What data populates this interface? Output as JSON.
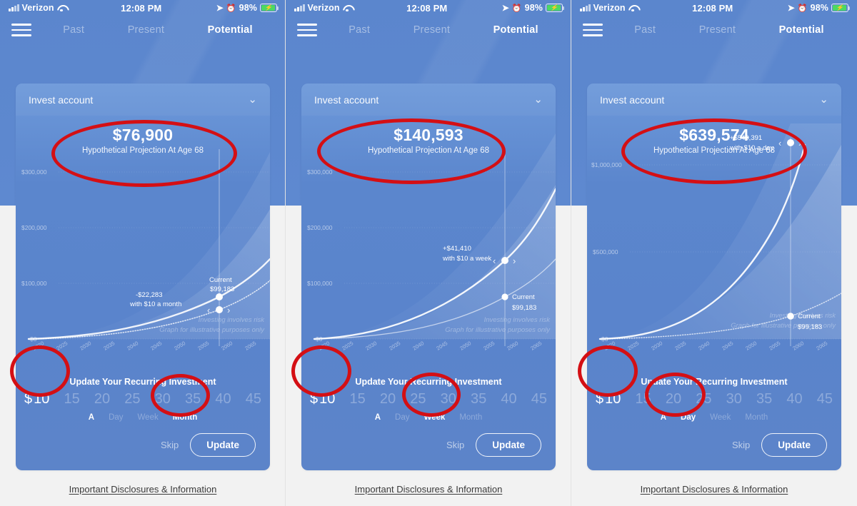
{
  "status_bar": {
    "carrier": "Verizon",
    "time": "12:08 PM",
    "battery_pct": "98%",
    "icons": [
      "signal-bars-icon",
      "wifi-icon",
      "location-arrow-icon",
      "alarm-clock-icon",
      "battery-charging-icon"
    ]
  },
  "nav": {
    "menu_icon": "hamburger-menu-icon",
    "tabs": [
      {
        "label": "Past",
        "active": false
      },
      {
        "label": "Present",
        "active": false
      },
      {
        "label": "Potential",
        "active": true
      }
    ]
  },
  "card": {
    "account_label": "Invest account",
    "chevron_icon": "chevron-down-icon",
    "projection_subtitle": "Hypothetical Projection At Age 68"
  },
  "controls": {
    "title": "Update Your Recurring Investment",
    "amounts": [
      "10",
      "15",
      "20",
      "25",
      "30",
      "35",
      "40",
      "45"
    ],
    "dollar_sign": "$",
    "prefix_a": "A",
    "frequencies": [
      "Day",
      "Week",
      "Month"
    ],
    "skip_label": "Skip",
    "update_label": "Update"
  },
  "footer": {
    "disclosure": "Important Disclosures & Information"
  },
  "chart_common": {
    "x_ticks": [
      "2020",
      "2025",
      "2030",
      "2035",
      "2040",
      "2045",
      "2050",
      "2055",
      "2060",
      "2065"
    ],
    "disclaimer_line1": "Investing involves risk",
    "disclaimer_line2": "Graph for illustrative purposes only",
    "current_label": "Current",
    "current_value": "$99,183",
    "marker_left_icon": "chevron-left-icon",
    "marker_right_icon": "chevron-right-icon"
  },
  "accent": {
    "annotation_red": "#d40f14",
    "app_blue": "#5b86cd",
    "card_blue": "#6d99da",
    "battery_green": "#4cd964"
  },
  "panels": [
    {
      "id": "panel-month",
      "projection_amount": "$76,900",
      "selected_amount": "10",
      "selected_frequency": "Month",
      "chart_data": {
        "type": "line",
        "title": "Hypothetical Projection At Age 68",
        "xlabel": "",
        "ylabel": "",
        "x": [
          2020,
          2025,
          2030,
          2035,
          2040,
          2045,
          2050,
          2055,
          2060,
          2065
        ],
        "y_ticks": [
          0,
          100000,
          200000,
          300000
        ],
        "y_tick_labels": [
          "$0",
          "$100,000",
          "$200,000",
          "$300,000"
        ],
        "ylim": [
          0,
          340000
        ],
        "xlim": [
          2020,
          2067
        ],
        "grid": true,
        "legend": "none",
        "annotations": [
          {
            "text": "-$22,283",
            "subtext": "with $10 a month",
            "x": 2052,
            "y": 62000
          },
          {
            "text": "Current",
            "subtext": "$99,183",
            "x": 2061,
            "y": 110000
          }
        ],
        "series": [
          {
            "name": "current",
            "values": [
              1000,
              3000,
              7000,
              14000,
              24000,
              38000,
              57000,
              78000,
              99183,
              128000
            ],
            "style": "solid"
          },
          {
            "name": "with-contribution",
            "values": [
              900,
              2600,
              6000,
              12000,
              20500,
              32000,
              47000,
              62000,
              76900,
              98000
            ],
            "style": "dotted"
          }
        ]
      }
    },
    {
      "id": "panel-week",
      "projection_amount": "$140,593",
      "selected_amount": "10",
      "selected_frequency": "Week",
      "chart_data": {
        "type": "line",
        "title": "Hypothetical Projection At Age 68",
        "xlabel": "",
        "ylabel": "",
        "x": [
          2020,
          2025,
          2030,
          2035,
          2040,
          2045,
          2050,
          2055,
          2060,
          2065
        ],
        "y_ticks": [
          0,
          100000,
          200000,
          300000
        ],
        "y_tick_labels": [
          "$0",
          "$100,000",
          "$200,000",
          "$300,000"
        ],
        "ylim": [
          0,
          340000
        ],
        "xlim": [
          2020,
          2067
        ],
        "grid": true,
        "legend": "none",
        "annotations": [
          {
            "text": "+$41,410",
            "subtext": "with $10 a week",
            "x": 2050,
            "y": 160000
          },
          {
            "text": "Current",
            "subtext": "$99,183",
            "x": 2062,
            "y": 99183
          }
        ],
        "series": [
          {
            "name": "with-contribution",
            "values": [
              1200,
              5000,
              12000,
              23000,
              38000,
              58000,
              84000,
              112000,
              140593,
              188000
            ],
            "style": "solid"
          },
          {
            "name": "current",
            "values": [
              1000,
              3000,
              7000,
              14000,
              24000,
              38000,
              57000,
              78000,
              99183,
              128000
            ],
            "style": "thin"
          }
        ]
      }
    },
    {
      "id": "panel-day",
      "projection_amount": "$639,574",
      "selected_amount": "10",
      "selected_frequency": "Day",
      "chart_data": {
        "type": "line",
        "title": "Hypothetical Projection At Age 68",
        "xlabel": "",
        "ylabel": "",
        "x": [
          2020,
          2025,
          2030,
          2035,
          2040,
          2045,
          2050,
          2055,
          2060,
          2065
        ],
        "y_ticks": [
          0,
          500000,
          1000000
        ],
        "y_tick_labels": [
          "$0",
          "$500,000",
          "$1,000,000"
        ],
        "ylim": [
          0,
          1200000
        ],
        "xlim": [
          2020,
          2067
        ],
        "grid": true,
        "legend": "none",
        "annotations": [
          {
            "text": "+$540,391",
            "subtext": "with $10 a day",
            "x": 2051,
            "y": 900000
          },
          {
            "text": "Current",
            "subtext": "$99,183",
            "x": 2062,
            "y": 99183
          }
        ],
        "series": [
          {
            "name": "with-contribution",
            "values": [
              4000,
              24000,
              58000,
              108000,
              180000,
              275000,
              400000,
              520000,
              639574,
              900000
            ],
            "style": "solid"
          },
          {
            "name": "current",
            "values": [
              1000,
              3000,
              7000,
              14000,
              24000,
              38000,
              57000,
              78000,
              99183,
              128000
            ],
            "style": "dotted"
          }
        ]
      }
    }
  ]
}
